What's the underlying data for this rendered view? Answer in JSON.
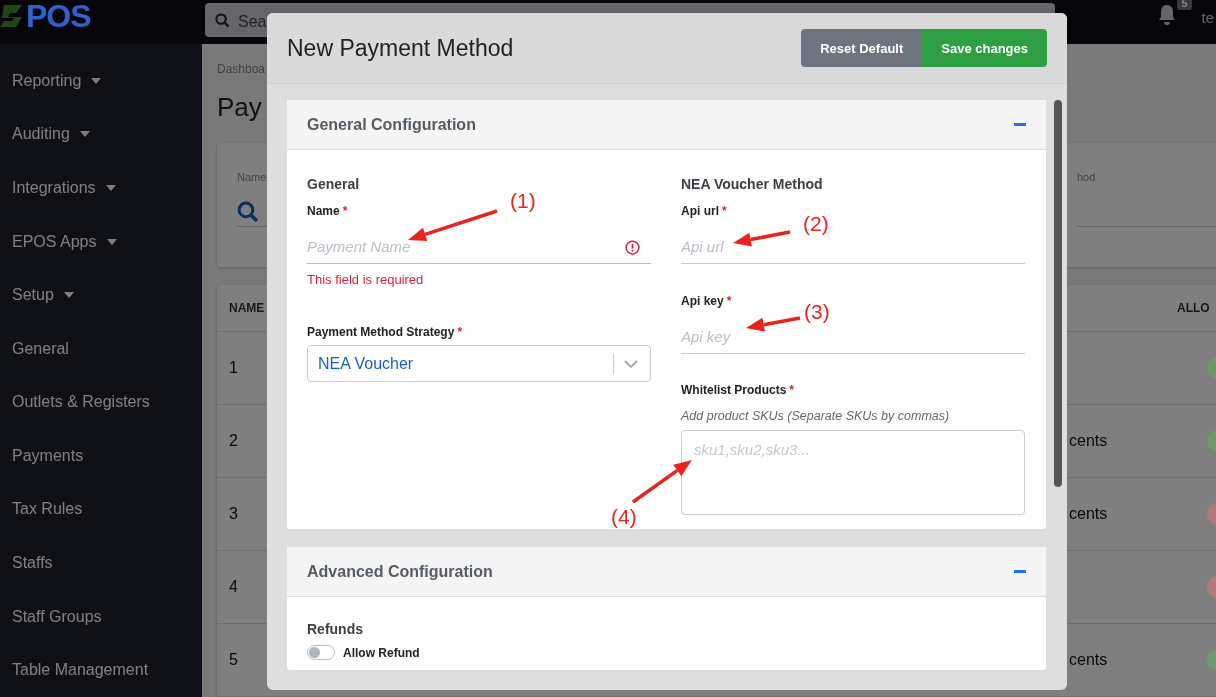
{
  "topbar": {
    "logo": "POS",
    "search_placeholder": "Sea",
    "notification_count": "5",
    "user": "te"
  },
  "sidebar": {
    "items": [
      {
        "label": "Reporting",
        "dropdown": true
      },
      {
        "label": "Auditing",
        "dropdown": true
      },
      {
        "label": "Integrations",
        "dropdown": true
      },
      {
        "label": "EPOS Apps",
        "dropdown": true
      },
      {
        "label": "Setup",
        "dropdown": true
      },
      {
        "label": "General",
        "dropdown": false
      },
      {
        "label": "Outlets & Registers",
        "dropdown": false
      },
      {
        "label": "Payments",
        "dropdown": false
      },
      {
        "label": "Tax Rules",
        "dropdown": false
      },
      {
        "label": "Staffs",
        "dropdown": false
      },
      {
        "label": "Staff Groups",
        "dropdown": false
      },
      {
        "label": "Table Management",
        "dropdown": false
      }
    ]
  },
  "page": {
    "breadcrumb": "Dashboa",
    "title": "Pay",
    "filters": [
      {
        "label": "Name"
      },
      {
        "label": "hod"
      }
    ],
    "table": {
      "columns": [
        "NAME",
        "ALLO"
      ],
      "rows": [
        {
          "name": "1",
          "column_2": "",
          "color": "#6e9a6a"
        },
        {
          "name": "2",
          "column_2": "cents",
          "color": "#6e9a6a"
        },
        {
          "name": "3",
          "column_2": "cents",
          "color": "#b07a7a"
        },
        {
          "name": "4",
          "column_2": "",
          "color": "#b07a7a"
        },
        {
          "name": "5",
          "column_2": "cents",
          "color": "#6e9a6a"
        }
      ]
    }
  },
  "modal": {
    "title": "New Payment Method",
    "buttons": [
      {
        "label": "Reset Default",
        "kind": "secondary"
      },
      {
        "label": "Save changes",
        "kind": "primary"
      }
    ],
    "general_section": {
      "title": "General Configuration",
      "expanded": true,
      "left": {
        "heading": "General",
        "name_field": {
          "label": "Name",
          "required_mark": "*",
          "placeholder": "Payment Name",
          "invalid": true,
          "error": "This field is required"
        },
        "strategy_field": {
          "label": "Payment Method Strategy",
          "required_mark": "*",
          "value": "NEA Voucher"
        }
      },
      "right": {
        "heading": "NEA Voucher Method",
        "fields": [
          {
            "label": "Api url",
            "required_mark": "*",
            "placeholder": "Api url"
          },
          {
            "label": "Api key",
            "required_mark": "*",
            "placeholder": "Api key"
          }
        ],
        "whitelist": {
          "label": "Whitelist Products",
          "required_mark": "*",
          "hint": "Add product SKUs (Separate SKUs by commas)",
          "placeholder": "sku1,sku2,sku3..."
        }
      }
    },
    "advanced_section": {
      "title": "Advanced Configuration",
      "expanded": true,
      "heading": "Refunds",
      "toggle": {
        "label": "Allow Refund",
        "on": false
      }
    }
  },
  "annotations": [
    {
      "label": "(1)"
    },
    {
      "label": "(2)"
    },
    {
      "label": "(3)"
    },
    {
      "label": "(4)"
    }
  ]
}
